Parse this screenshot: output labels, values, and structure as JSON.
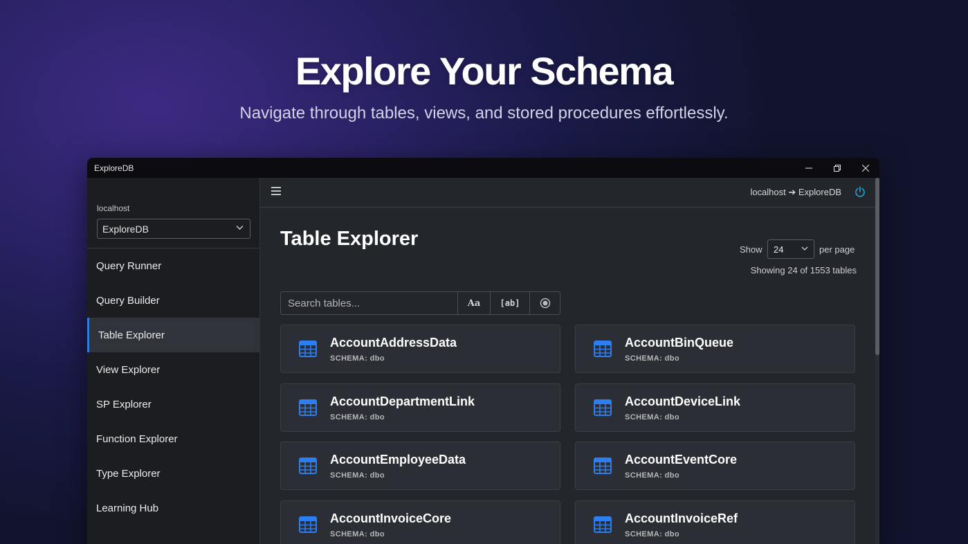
{
  "hero": {
    "title": "Explore Your Schema",
    "subtitle": "Navigate through tables, views, and stored procedures effortlessly."
  },
  "window": {
    "title": "ExploreDB"
  },
  "sidebar": {
    "server": "localhost",
    "database": "ExploreDB",
    "items": [
      {
        "label": "Query Runner",
        "active": false
      },
      {
        "label": "Query Builder",
        "active": false
      },
      {
        "label": "Table Explorer",
        "active": true
      },
      {
        "label": "View Explorer",
        "active": false
      },
      {
        "label": "SP Explorer",
        "active": false
      },
      {
        "label": "Function Explorer",
        "active": false
      },
      {
        "label": "Type Explorer",
        "active": false
      },
      {
        "label": "Learning Hub",
        "active": false
      }
    ]
  },
  "topbar": {
    "connection": "localhost ➔ ExploreDB"
  },
  "main": {
    "title": "Table Explorer",
    "show_label": "Show",
    "per_page_value": "24",
    "per_page_label": "per page",
    "showing": "Showing 24 of 1553 tables",
    "search_placeholder": "Search tables...",
    "option_case": "Aa",
    "option_word": "[ab]"
  },
  "tables": [
    {
      "name": "AccountAddressData",
      "schema": "SCHEMA: dbo"
    },
    {
      "name": "AccountBinQueue",
      "schema": "SCHEMA: dbo"
    },
    {
      "name": "AccountDepartmentLink",
      "schema": "SCHEMA: dbo"
    },
    {
      "name": "AccountDeviceLink",
      "schema": "SCHEMA: dbo"
    },
    {
      "name": "AccountEmployeeData",
      "schema": "SCHEMA: dbo"
    },
    {
      "name": "AccountEventCore",
      "schema": "SCHEMA: dbo"
    },
    {
      "name": "AccountInvoiceCore",
      "schema": "SCHEMA: dbo"
    },
    {
      "name": "AccountInvoiceRef",
      "schema": "SCHEMA: dbo"
    }
  ],
  "colors": {
    "accent": "#2f7de1",
    "table_icon": "#2d7ef0",
    "power_icon": "#1ea7d8"
  }
}
